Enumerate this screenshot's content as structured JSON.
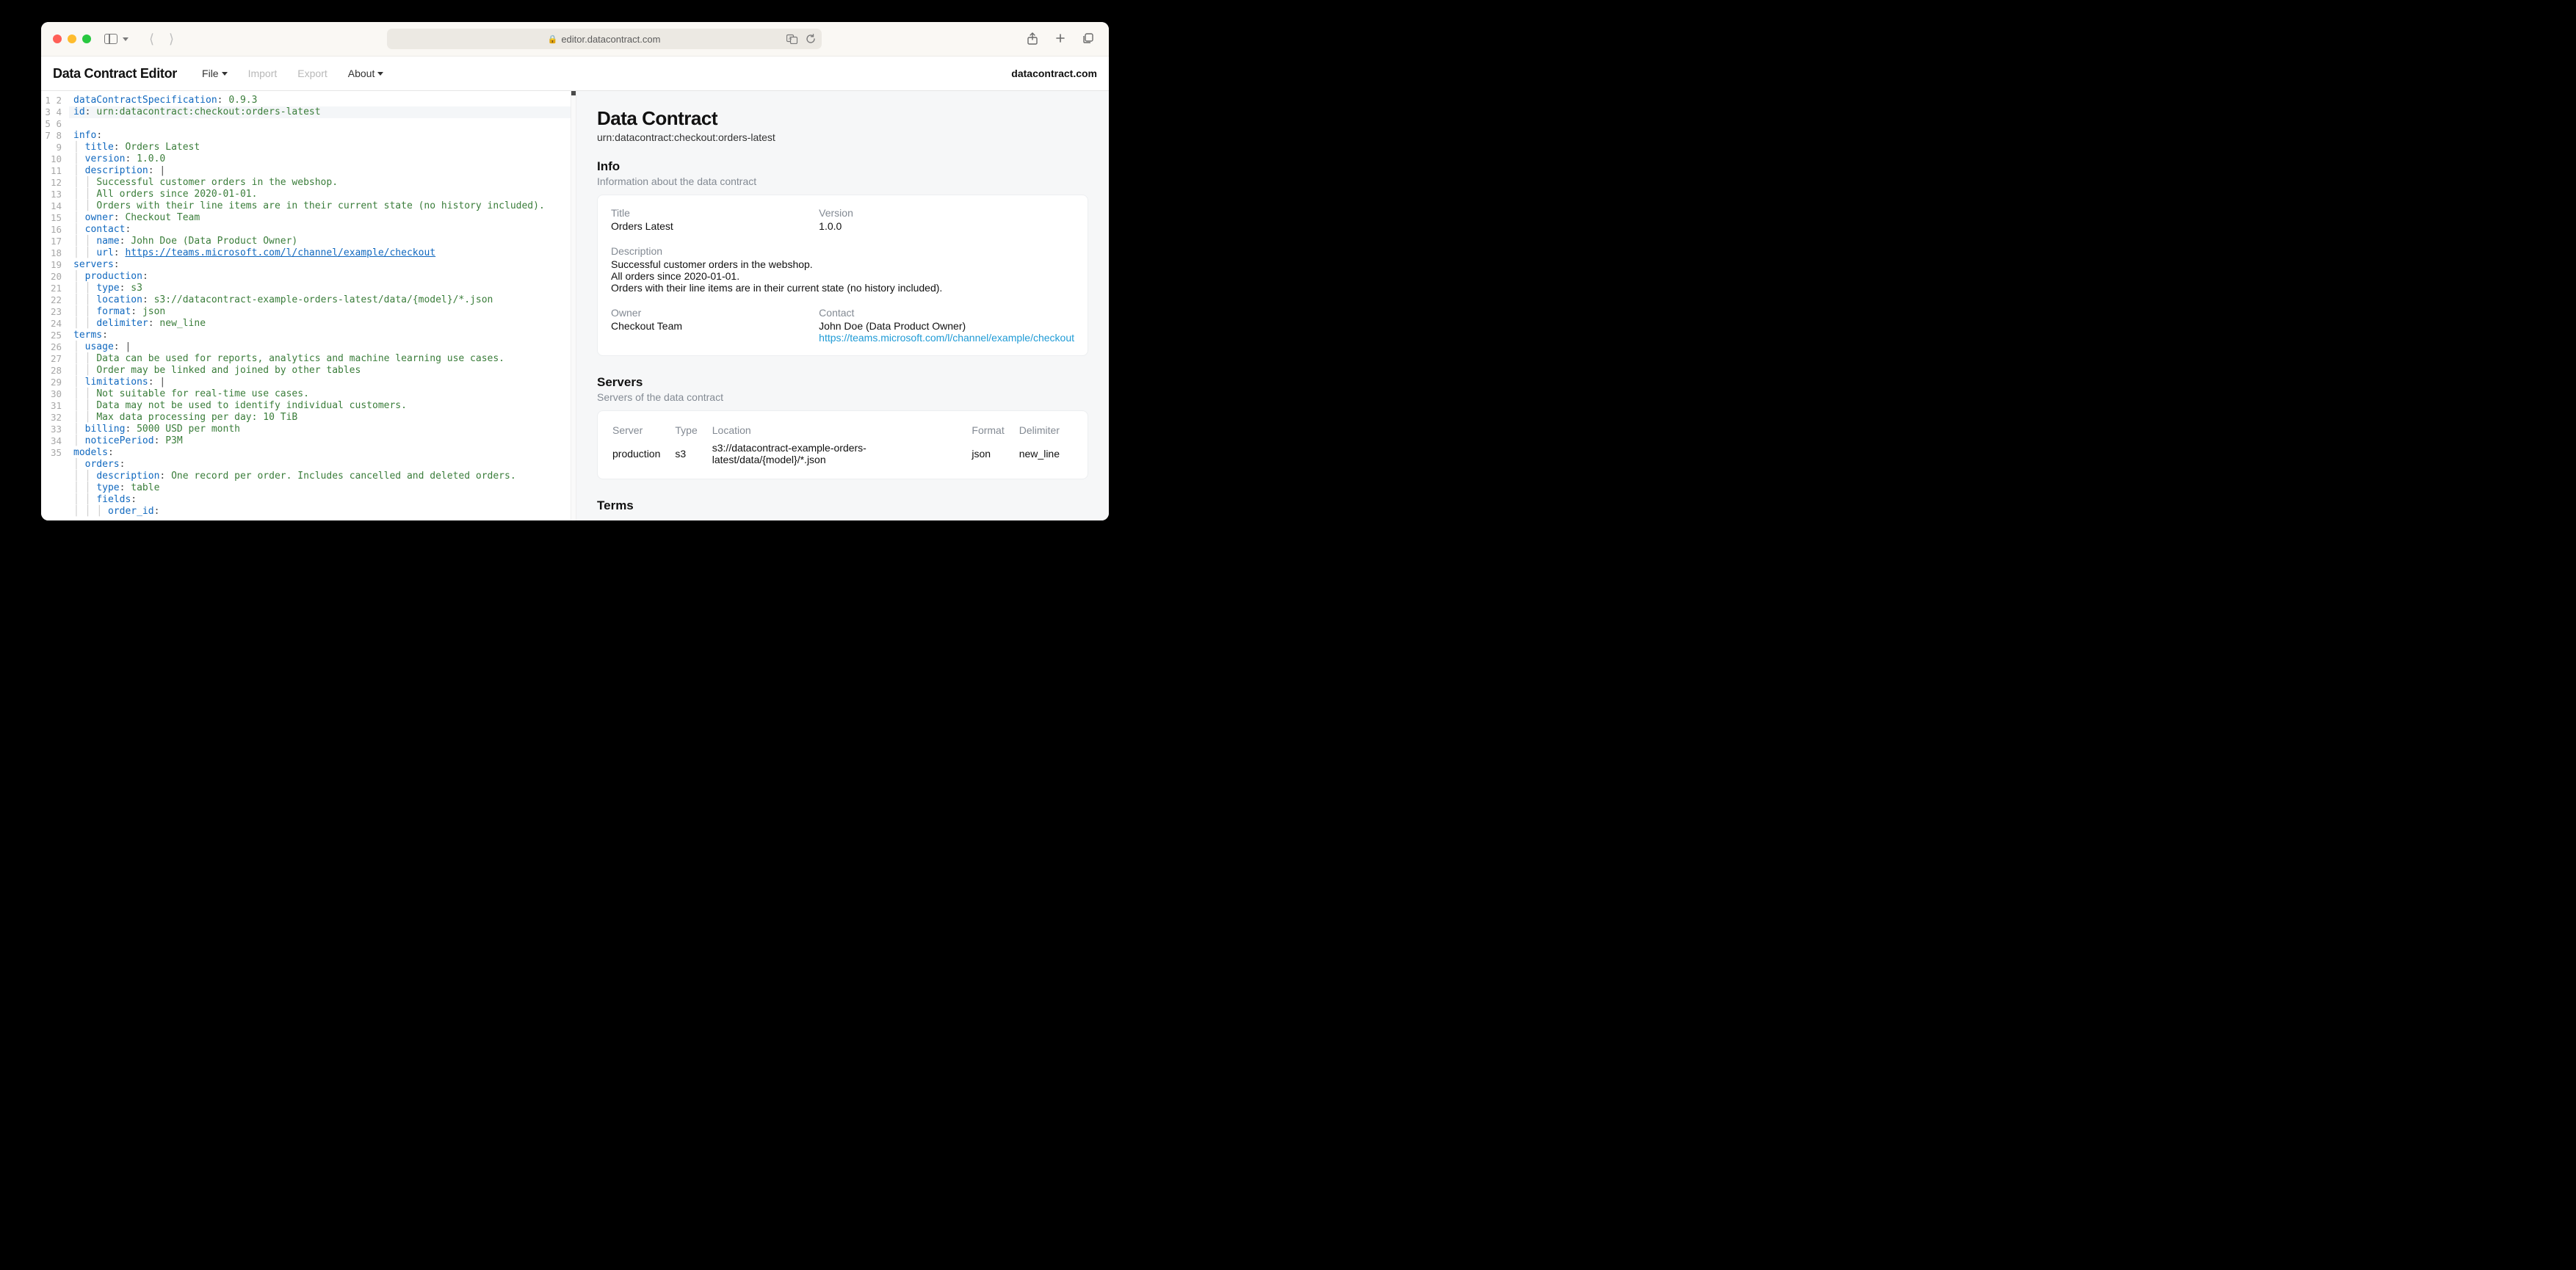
{
  "browser": {
    "url_display": "editor.datacontract.com"
  },
  "header": {
    "app_title": "Data Contract Editor",
    "menu": {
      "file": "File",
      "import": "Import",
      "export": "Export",
      "about": "About"
    },
    "site_link": "datacontract.com"
  },
  "editor": {
    "lines": [
      [
        {
          "t": "key",
          "v": "dataContractSpecification"
        },
        {
          "t": "p",
          "v": ": "
        },
        {
          "t": "num",
          "v": "0.9.3"
        }
      ],
      [
        {
          "t": "key",
          "v": "id"
        },
        {
          "t": "p",
          "v": ": "
        },
        {
          "t": "str",
          "v": "urn:datacontract:checkout:orders-latest"
        }
      ],
      [
        {
          "t": "key",
          "v": "info"
        },
        {
          "t": "p",
          "v": ":"
        }
      ],
      [
        {
          "t": "ind",
          "v": "  "
        },
        {
          "t": "key",
          "v": "title"
        },
        {
          "t": "p",
          "v": ": "
        },
        {
          "t": "str",
          "v": "Orders Latest"
        }
      ],
      [
        {
          "t": "ind",
          "v": "  "
        },
        {
          "t": "key",
          "v": "version"
        },
        {
          "t": "p",
          "v": ": "
        },
        {
          "t": "num",
          "v": "1.0.0"
        }
      ],
      [
        {
          "t": "ind",
          "v": "  "
        },
        {
          "t": "key",
          "v": "description"
        },
        {
          "t": "p",
          "v": ": |"
        }
      ],
      [
        {
          "t": "ind",
          "v": "    "
        },
        {
          "t": "str",
          "v": "Successful customer orders in the webshop."
        }
      ],
      [
        {
          "t": "ind",
          "v": "    "
        },
        {
          "t": "str",
          "v": "All orders since 2020-01-01."
        }
      ],
      [
        {
          "t": "ind",
          "v": "    "
        },
        {
          "t": "str",
          "v": "Orders with their line items are in their current state (no history included)."
        }
      ],
      [
        {
          "t": "ind",
          "v": "  "
        },
        {
          "t": "key",
          "v": "owner"
        },
        {
          "t": "p",
          "v": ": "
        },
        {
          "t": "str",
          "v": "Checkout Team"
        }
      ],
      [
        {
          "t": "ind",
          "v": "  "
        },
        {
          "t": "key",
          "v": "contact"
        },
        {
          "t": "p",
          "v": ":"
        }
      ],
      [
        {
          "t": "ind",
          "v": "    "
        },
        {
          "t": "key",
          "v": "name"
        },
        {
          "t": "p",
          "v": ": "
        },
        {
          "t": "str",
          "v": "John Doe (Data Product Owner)"
        }
      ],
      [
        {
          "t": "ind",
          "v": "    "
        },
        {
          "t": "key",
          "v": "url"
        },
        {
          "t": "p",
          "v": ": "
        },
        {
          "t": "url",
          "v": "https://teams.microsoft.com/l/channel/example/checkout"
        }
      ],
      [
        {
          "t": "key",
          "v": "servers"
        },
        {
          "t": "p",
          "v": ":"
        }
      ],
      [
        {
          "t": "ind",
          "v": "  "
        },
        {
          "t": "key",
          "v": "production"
        },
        {
          "t": "p",
          "v": ":"
        }
      ],
      [
        {
          "t": "ind",
          "v": "    "
        },
        {
          "t": "key",
          "v": "type"
        },
        {
          "t": "p",
          "v": ": "
        },
        {
          "t": "str",
          "v": "s3"
        }
      ],
      [
        {
          "t": "ind",
          "v": "    "
        },
        {
          "t": "key",
          "v": "location"
        },
        {
          "t": "p",
          "v": ": "
        },
        {
          "t": "str",
          "v": "s3://datacontract-example-orders-latest/data/{model}/*.json"
        }
      ],
      [
        {
          "t": "ind",
          "v": "    "
        },
        {
          "t": "key",
          "v": "format"
        },
        {
          "t": "p",
          "v": ": "
        },
        {
          "t": "str",
          "v": "json"
        }
      ],
      [
        {
          "t": "ind",
          "v": "    "
        },
        {
          "t": "key",
          "v": "delimiter"
        },
        {
          "t": "p",
          "v": ": "
        },
        {
          "t": "str",
          "v": "new_line"
        }
      ],
      [
        {
          "t": "key",
          "v": "terms"
        },
        {
          "t": "p",
          "v": ":"
        }
      ],
      [
        {
          "t": "ind",
          "v": "  "
        },
        {
          "t": "key",
          "v": "usage"
        },
        {
          "t": "p",
          "v": ": |"
        }
      ],
      [
        {
          "t": "ind",
          "v": "    "
        },
        {
          "t": "str",
          "v": "Data can be used for reports, analytics and machine learning use cases."
        }
      ],
      [
        {
          "t": "ind",
          "v": "    "
        },
        {
          "t": "str",
          "v": "Order may be linked and joined by other tables"
        }
      ],
      [
        {
          "t": "ind",
          "v": "  "
        },
        {
          "t": "key",
          "v": "limitations"
        },
        {
          "t": "p",
          "v": ": |"
        }
      ],
      [
        {
          "t": "ind",
          "v": "    "
        },
        {
          "t": "str",
          "v": "Not suitable for real-time use cases."
        }
      ],
      [
        {
          "t": "ind",
          "v": "    "
        },
        {
          "t": "str",
          "v": "Data may not be used to identify individual customers."
        }
      ],
      [
        {
          "t": "ind",
          "v": "    "
        },
        {
          "t": "str",
          "v": "Max data processing per day: 10 TiB"
        }
      ],
      [
        {
          "t": "ind",
          "v": "  "
        },
        {
          "t": "key",
          "v": "billing"
        },
        {
          "t": "p",
          "v": ": "
        },
        {
          "t": "str",
          "v": "5000 USD per month"
        }
      ],
      [
        {
          "t": "ind",
          "v": "  "
        },
        {
          "t": "key",
          "v": "noticePeriod"
        },
        {
          "t": "p",
          "v": ": "
        },
        {
          "t": "str",
          "v": "P3M"
        }
      ],
      [
        {
          "t": "key",
          "v": "models"
        },
        {
          "t": "p",
          "v": ":"
        }
      ],
      [
        {
          "t": "ind",
          "v": "  "
        },
        {
          "t": "key",
          "v": "orders"
        },
        {
          "t": "p",
          "v": ":"
        }
      ],
      [
        {
          "t": "ind",
          "v": "    "
        },
        {
          "t": "key",
          "v": "description"
        },
        {
          "t": "p",
          "v": ": "
        },
        {
          "t": "str",
          "v": "One record per order. Includes cancelled and deleted orders."
        }
      ],
      [
        {
          "t": "ind",
          "v": "    "
        },
        {
          "t": "key",
          "v": "type"
        },
        {
          "t": "p",
          "v": ": "
        },
        {
          "t": "str",
          "v": "table"
        }
      ],
      [
        {
          "t": "ind",
          "v": "    "
        },
        {
          "t": "key",
          "v": "fields"
        },
        {
          "t": "p",
          "v": ":"
        }
      ],
      [
        {
          "t": "ind",
          "v": "      "
        },
        {
          "t": "key",
          "v": "order_id"
        },
        {
          "t": "p",
          "v": ":"
        }
      ]
    ],
    "active_line_index": 1
  },
  "preview": {
    "title": "Data Contract",
    "id": "urn:datacontract:checkout:orders-latest",
    "info": {
      "heading": "Info",
      "sub": "Information about the data contract",
      "labels": {
        "title": "Title",
        "version": "Version",
        "description": "Description",
        "owner": "Owner",
        "contact": "Contact"
      },
      "title": "Orders Latest",
      "version": "1.0.0",
      "description_l1": "Successful customer orders in the webshop.",
      "description_l2": "All orders since 2020-01-01.",
      "description_l3": "Orders with their line items are in their current state (no history included).",
      "owner": "Checkout Team",
      "contact_name": "John Doe (Data Product Owner)",
      "contact_url": "https://teams.microsoft.com/l/channel/example/checkout"
    },
    "servers": {
      "heading": "Servers",
      "sub": "Servers of the data contract",
      "cols": {
        "server": "Server",
        "type": "Type",
        "location": "Location",
        "format": "Format",
        "delimiter": "Delimiter"
      },
      "rows": [
        {
          "server": "production",
          "type": "s3",
          "location": "s3://datacontract-example-orders-latest/data/{model}/*.json",
          "format": "json",
          "delimiter": "new_line"
        }
      ]
    },
    "terms": {
      "heading": "Terms"
    }
  }
}
